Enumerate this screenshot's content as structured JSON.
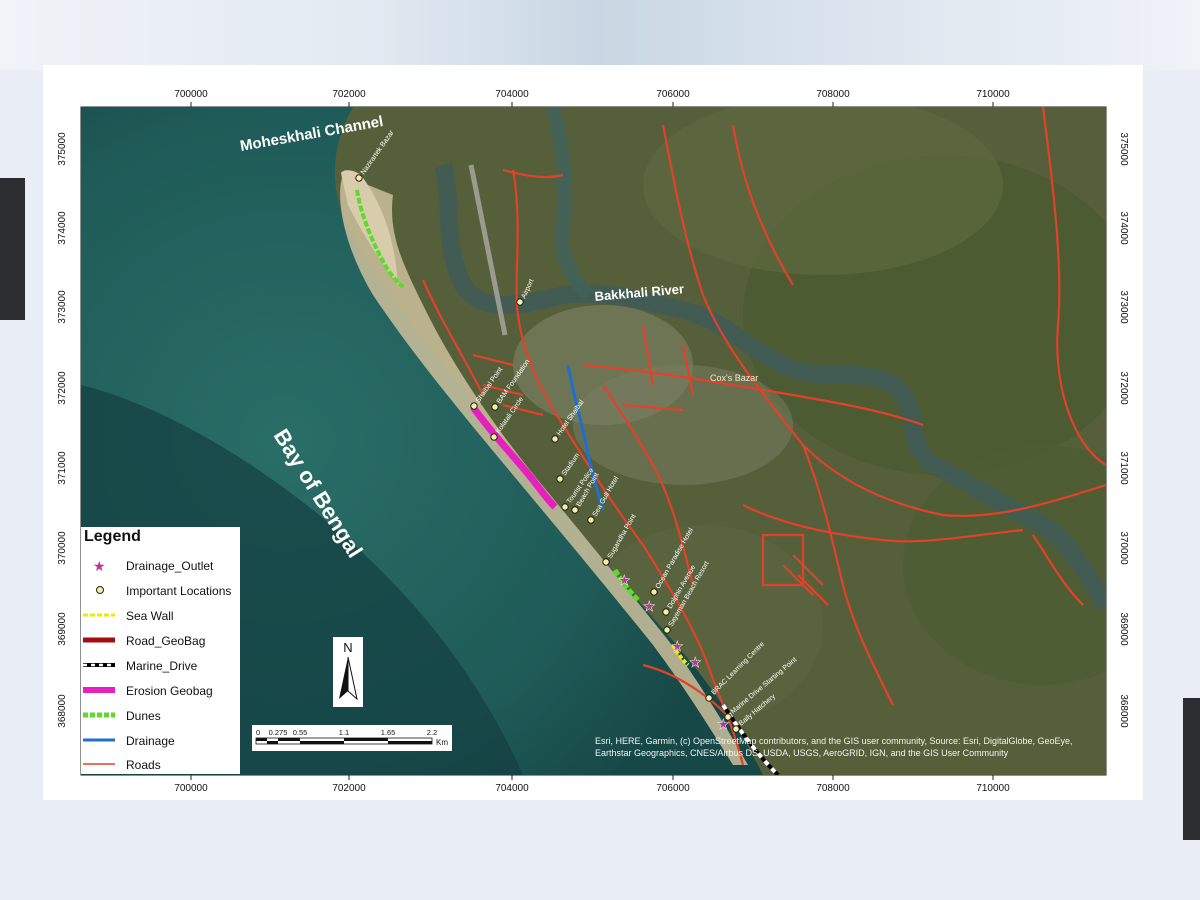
{
  "map": {
    "x_ticks": [
      "700000",
      "702000",
      "704000",
      "706000",
      "708000",
      "710000"
    ],
    "y_ticks": [
      "375000",
      "374000",
      "373000",
      "372000",
      "371000",
      "370000",
      "369000",
      "368000"
    ],
    "water_labels": {
      "channel": "Moheskhali Channel",
      "river": "Bakkhali River",
      "bay": "Bay of Bengal",
      "town": "Cox's Bazar"
    },
    "locations": [
      "Nazirartek Bazar",
      "Airport",
      "Shaibal Point",
      "BAM Foundation",
      "Kolatali Circle",
      "Hotel Shaibal",
      "Stadium",
      "Tourist Police",
      "Beach Point",
      "Sugandha Point",
      "Sea Gull Hotel",
      "Ocean Paradise Hotel",
      "Dolphin Avenue",
      "Sayeman Beach Resort",
      "BRAC Learning Centre",
      "Marine Drive Starting Point",
      "Baily Hatchery"
    ],
    "colors": {
      "roads": "#e2412a",
      "drainage": "#1d6fd0",
      "erosion_geobag": "#e61fbf",
      "dunes": "#5bdc28",
      "sea_wall": "#f2e60a",
      "road_geobag": "#a30f0f",
      "sea": "#1d5a5a",
      "land": "#4b5a34"
    }
  },
  "legend": {
    "title": "Legend",
    "items": [
      {
        "label": "Drainage_Outlet",
        "icon": "purple-star-icon"
      },
      {
        "label": "Important Locations",
        "icon": "yellow-circle-icon"
      },
      {
        "label": "Sea Wall",
        "icon": "yellow-dashed-line"
      },
      {
        "label": "Road_GeoBag",
        "icon": "dark-red-line"
      },
      {
        "label": "Marine_Drive",
        "icon": "black-white-dashed-line"
      },
      {
        "label": "Erosion Geobag",
        "icon": "magenta-line"
      },
      {
        "label": "Dunes",
        "icon": "green-dashed-line"
      },
      {
        "label": "Drainage",
        "icon": "blue-line"
      },
      {
        "label": "Roads",
        "icon": "red-line"
      }
    ]
  },
  "north_arrow": "N",
  "scale_bar": {
    "labels": [
      "0",
      "0.275",
      "0.55",
      "1.1",
      "1.65",
      "2.2"
    ],
    "unit": "Km"
  },
  "attribution": "Esri, HERE, Garmin, (c) OpenStreetMap contributors, and the GIS user community, Source: Esri, DigitalGlobe, GeoEye, Earthstar Geographics, CNES/Airbus DS, USDA, USGS, AeroGRID, IGN, and the GIS User Community"
}
